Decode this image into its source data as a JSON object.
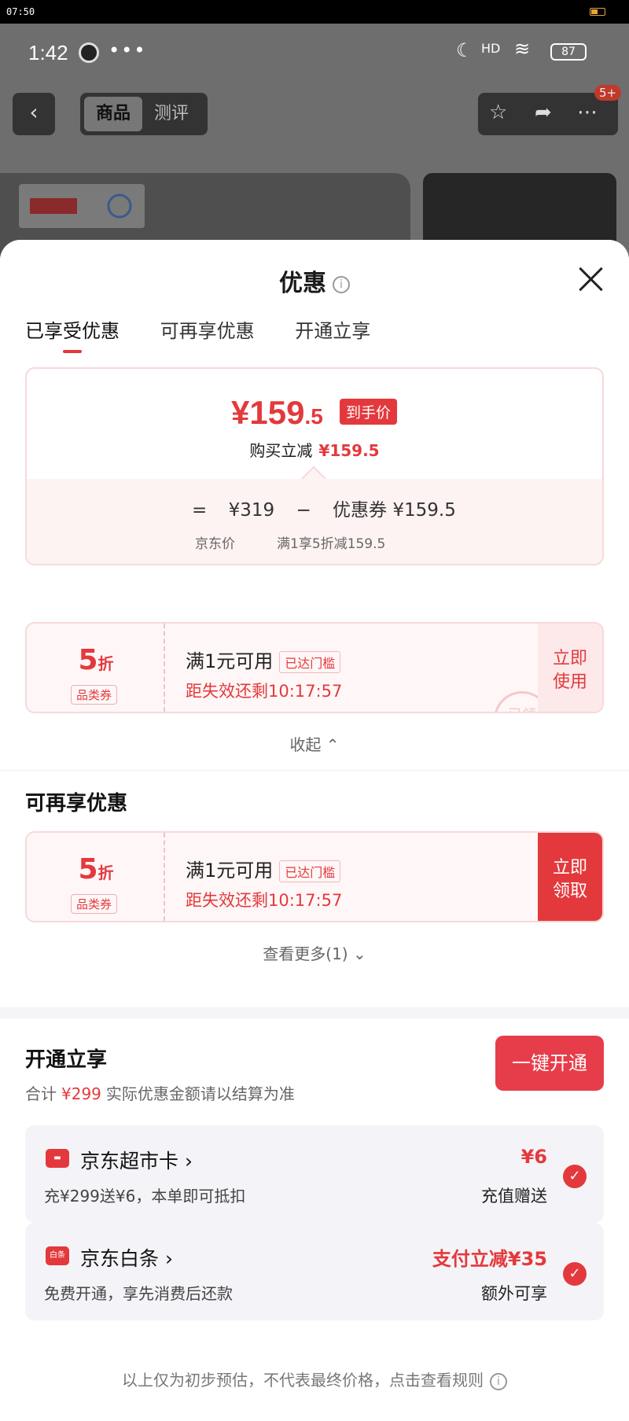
{
  "os": {
    "time": "07:50"
  },
  "status": {
    "time": "1:42",
    "dots": "•••",
    "battery": "87",
    "signal": "HD"
  },
  "nav": {
    "back": "‹",
    "tabs": [
      {
        "label": "商品"
      },
      {
        "label": "测评"
      }
    ],
    "badge": "5+"
  },
  "sheet": {
    "title": "优惠",
    "tabs": [
      {
        "label": "已享受优惠"
      },
      {
        "label": "可再享优惠"
      },
      {
        "label": "开通立享"
      }
    ]
  },
  "price": {
    "big": "¥159",
    "decimal": ".5",
    "tag": "到手价",
    "buy_label": "购买立减",
    "buy_value": "¥159.5",
    "equals": "=",
    "orig": "¥319",
    "minus": "−",
    "coupon": "优惠券 ¥159.5",
    "orig_label": "京东价",
    "coupon_label": "满1享5折减159.5"
  },
  "coupon1": {
    "discount": "5",
    "unit": "折",
    "category": "品类券",
    "title": "满1元可用",
    "reach": "已达门槛",
    "timer": "距失效还剩10:17:57",
    "action_l1": "立即",
    "action_l2": "使用",
    "stamp": "已领"
  },
  "fold_label": "收起 ⌃",
  "section2": {
    "title": "可再享优惠",
    "more": "查看更多(1) ⌄"
  },
  "coupon2": {
    "discount": "5",
    "unit": "折",
    "category": "品类券",
    "title": "满1元可用",
    "reach": "已达门槛",
    "timer": "距失效还剩10:17:57",
    "action_l1": "立即",
    "action_l2": "领取"
  },
  "section3": {
    "title": "开通立享",
    "button": "一键开通",
    "sum_prefix": "合计",
    "sum_value": "¥299",
    "sum_suffix": "实际优惠金额请以结算为准"
  },
  "cards": [
    {
      "name": "京东超市卡 ›",
      "desc": "充¥299送¥6，本单即可抵扣",
      "amount": "¥6",
      "note": "充值赠送",
      "icon": "card-icon"
    },
    {
      "name": "京东白条 ›",
      "desc": "免费开通，享先消费后还款",
      "amount": "支付立减¥35",
      "note": "额外可享",
      "icon_text": "白条"
    }
  ],
  "footer": "以上仅为初步预估，不代表最终价格，点击查看规则"
}
